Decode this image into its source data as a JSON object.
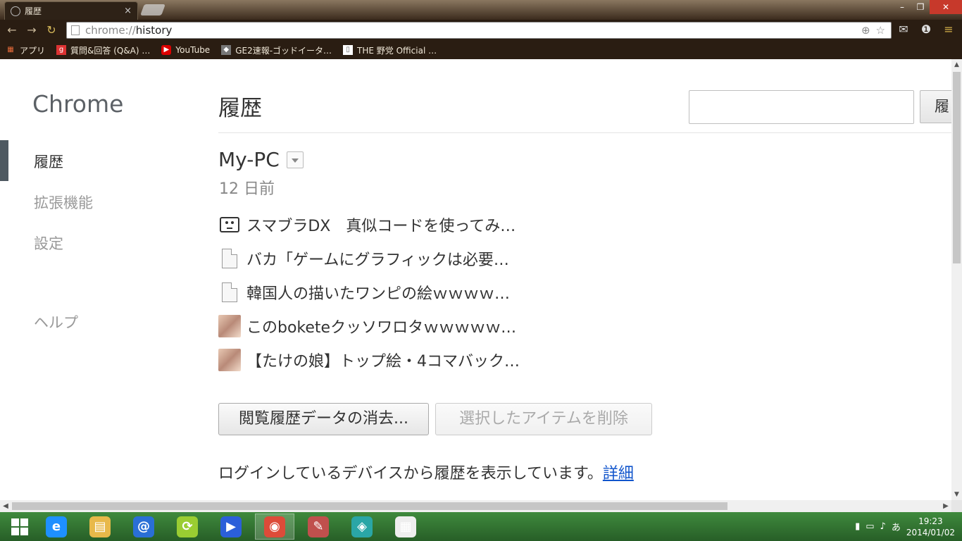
{
  "window": {
    "tab_title": "履歴",
    "tab_close": "×",
    "controls": {
      "minimize": "–",
      "maximize": "❐",
      "close": "✕"
    }
  },
  "toolbar": {
    "back": "←",
    "forward": "→",
    "reload": "↻",
    "url_scheme": "chrome://",
    "url_path": "history",
    "zoom_icon": "⊕",
    "star_icon": "☆",
    "menu_icon": "≡"
  },
  "bookmarks": [
    {
      "label": "アプリ",
      "icon": "apps-grid-icon"
    },
    {
      "label": "質問&回答 (Q&A) …",
      "icon": "qa-site-icon"
    },
    {
      "label": "YouTube",
      "icon": "youtube-icon"
    },
    {
      "label": "GE2速報-ゴッドイータ…",
      "icon": "ge2-site-icon"
    },
    {
      "label": "THE 野党 Official …",
      "icon": "page-icon"
    }
  ],
  "sidebar": {
    "brand": "Chrome",
    "items": [
      {
        "label": "履歴",
        "active": true
      },
      {
        "label": "拡張機能",
        "active": false
      },
      {
        "label": "設定",
        "active": false
      }
    ],
    "help": "ヘルプ"
  },
  "main": {
    "title": "履歴",
    "search_button": "履",
    "device": "My-PC",
    "day": "12 日前",
    "entries": [
      {
        "title": "スマブラDX　真似コードを使ってみ…",
        "icon": "niconico-tv-icon"
      },
      {
        "title": "バカ「ゲームにグラフィックは必要…",
        "icon": "page-icon"
      },
      {
        "title": "韓国人の描いたワンピの絵ｗｗｗｗ…",
        "icon": "page-icon"
      },
      {
        "title": "このboketeクッソワロタｗｗｗｗｗ…",
        "icon": "thumbnail-icon"
      },
      {
        "title": "【たけの娘】トップ絵・4コマバック…",
        "icon": "thumbnail-icon"
      }
    ],
    "clear_button": "閲覧履歴データの消去...",
    "remove_button": "選択したアイテムを削除",
    "footnote": "ログインしているデバイスから履歴を表示しています。",
    "footnote_link": "詳細"
  },
  "taskbar": {
    "apps": [
      {
        "name": "start",
        "glyph": ""
      },
      {
        "name": "internet-explorer",
        "glyph": "e",
        "color": "#1e90ff"
      },
      {
        "name": "file-explorer",
        "glyph": "▤",
        "color": "#e8b94a"
      },
      {
        "name": "mail-at",
        "glyph": "@",
        "color": "#2a6fd6"
      },
      {
        "name": "sync-app",
        "glyph": "⟳",
        "color": "#9acd32"
      },
      {
        "name": "media-player",
        "glyph": "▶",
        "color": "#2b5fd9"
      },
      {
        "name": "chrome",
        "glyph": "◉",
        "color": "#dd4b39"
      },
      {
        "name": "paint",
        "glyph": "✎",
        "color": "#c0504d"
      },
      {
        "name": "network-app",
        "glyph": "◈",
        "color": "#2aa6a6"
      },
      {
        "name": "apps-grid",
        "glyph": "▦",
        "color": "#eeeeee"
      }
    ],
    "time": "19:23",
    "date": "2014/01/02",
    "ime": "あ"
  }
}
